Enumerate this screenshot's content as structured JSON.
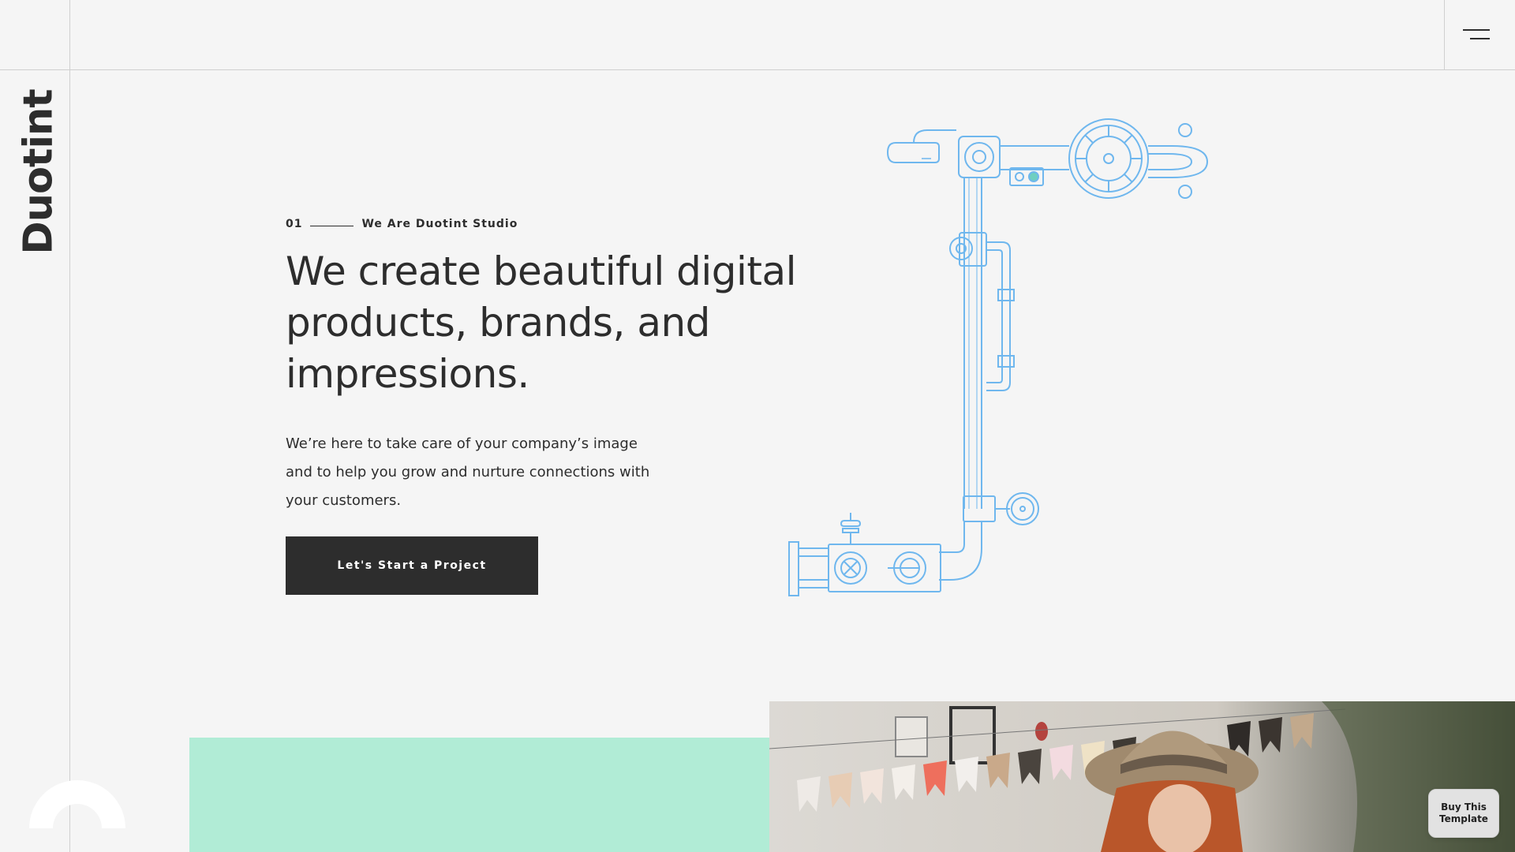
{
  "brand": {
    "name": "Duotint"
  },
  "menu": {
    "icon": "hamburger-menu-icon"
  },
  "hero": {
    "eyebrow_number": "01",
    "eyebrow_text": "We Are Duotint Studio",
    "headline": "We create beautiful digital products, brands, and impressions.",
    "lead": "We’re here to take care of your company’s image and to help you grow and nurture connections with your customers.",
    "cta_label": "Let's Start a Project",
    "illustration": "pipe-valve-illustration"
  },
  "buy_template": {
    "label": "Buy This Template"
  },
  "colors": {
    "background": "#f5f5f5",
    "text": "#2d2d2d",
    "mint": "#b1ecd6",
    "line_blue": "#6fb7ee",
    "button_dark": "#2d2d2d"
  }
}
